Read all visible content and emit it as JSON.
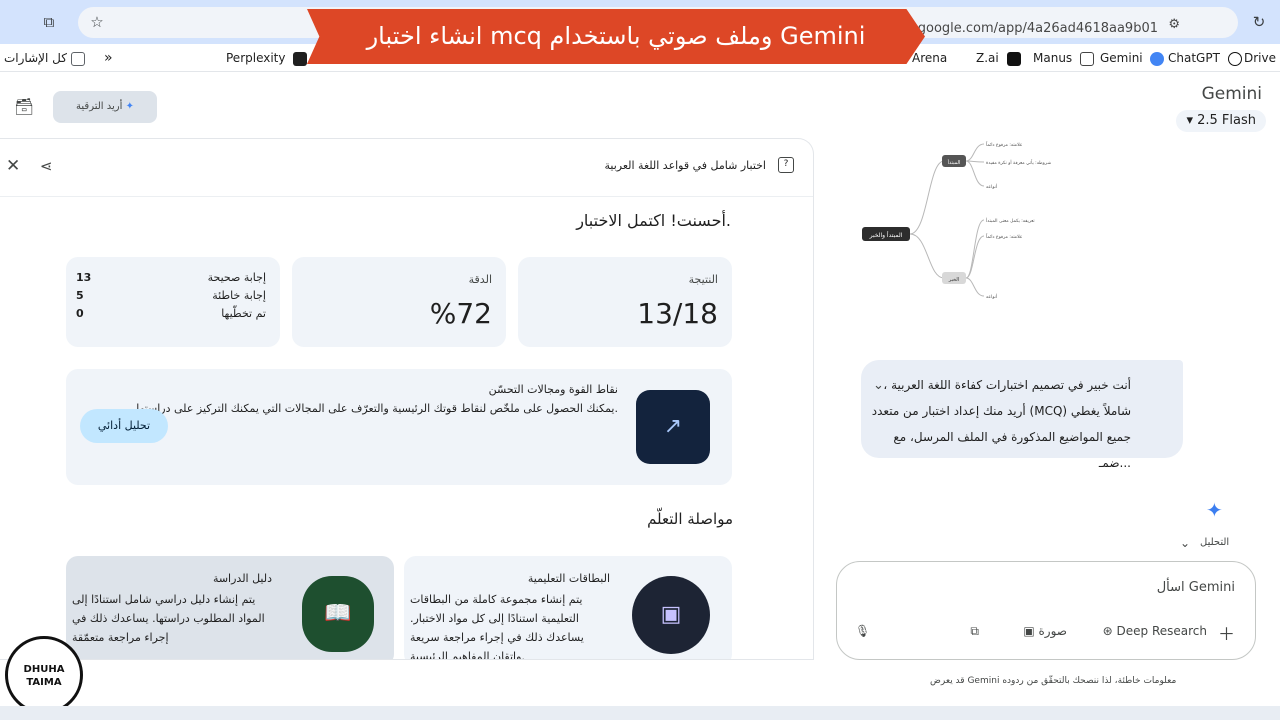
{
  "browser": {
    "url": "gemini.google.com/app/4a26ad4618aa9b01",
    "bookmarks": [
      {
        "label": "كل الإشارات",
        "color": "#5f6368"
      },
      {
        "label": "Perplexity",
        "color": "#20808d"
      },
      {
        "label": "Arena",
        "color": "#3c4043"
      },
      {
        "label": "Z.ai",
        "color": "#000000"
      },
      {
        "label": "Manus",
        "color": "#3c4043"
      },
      {
        "label": "Gemini",
        "color": "#4285f4"
      },
      {
        "label": "ChatGPT",
        "color": "#10a37f"
      },
      {
        "label": "Drive",
        "color": "#fbbc04"
      }
    ]
  },
  "banner": {
    "text": "انشاء اختبار mcq وملف صوتي باستخدام Gemini",
    "color": "#dd4726"
  },
  "header": {
    "brand": "Gemini",
    "model": "2.5 Flash",
    "upgrade": "أريد الترقية"
  },
  "canvas": {
    "title": "اختبار شامل في قواعد اللغة العربية",
    "done_message": "أحسنت! اكتمل الاختبار.",
    "score": {
      "label": "النتيجة",
      "value": "13/18"
    },
    "accuracy": {
      "label": "الدقة",
      "value": "%72"
    },
    "breakdown": [
      {
        "label": "إجابة صحيحة",
        "count": "13"
      },
      {
        "label": "إجابة خاطئة",
        "count": "5"
      },
      {
        "label": "تم تخطّيها",
        "count": "0"
      }
    ],
    "performance": {
      "title": "نقاط القوة ومجالات التحسّن",
      "description": "يمكنك الحصول على ملخّص لنقاط قوتك الرئيسية والتعرّف على المجالات التي يمكنك التركيز على دراستها.",
      "button": "تحليل أدائي"
    },
    "section_title": "مواصلة التعلّم",
    "cards": [
      {
        "title": "البطاقات التعليمية",
        "description": "يتم إنشاء مجموعة كاملة من البطاقات التعليمية استنادًا إلى كل مواد الاختبار. يساعدك ذلك في إجراء مراجعة سريعة وإتقان المفاهيم الرئيسية."
      },
      {
        "title": "دليل الدراسة",
        "description": "يتم إنشاء دليل دراسي شامل استنادًا إلى المواد المطلوب دراستها. يساعدك ذلك في إجراء مراجعة متعمّقة"
      }
    ]
  },
  "chat": {
    "mindmap": {
      "root": "المبتدأ والخبر",
      "branches": [
        {
          "label": "المبتدأ",
          "children": [
            "علامته: مرفوع دائماً",
            "شروطه: يأتي معرفة أو نكرة مفيدة",
            "أنواعه"
          ]
        },
        {
          "label": "الخبر",
          "children": [
            "تعريفه: يكمل معنى المبتدأ",
            "علامته: مرفوع دائماً",
            "أنواعه"
          ]
        }
      ]
    },
    "user_message": "أنت خبير في تصميم اختبارات كفاءة اللغة العربية ، أريد منك إعداد اختبار من متعدد (MCQ) شاملاً يغطي جميع المواضيع المذكورة في الملف المرسل، مع ضمـ...",
    "analysis_label": "التحليل",
    "composer": {
      "placeholder": "اسأل Gemini",
      "deep_research": "Deep Research",
      "image_label": "صورة"
    },
    "disclaimer": "قد يعرض Gemini معلومات خاطئة، لذا ننصحك بالتحقّق من ردوده"
  },
  "watermark": {
    "line1": "DHUHA",
    "line2": "TAIMA"
  }
}
